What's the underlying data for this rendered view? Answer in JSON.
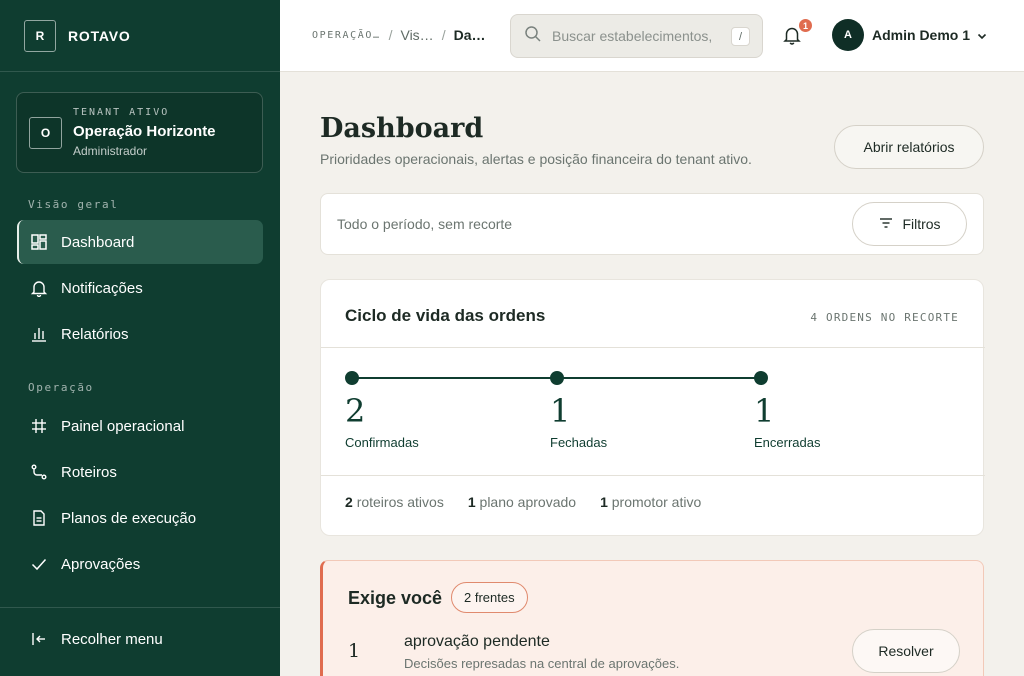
{
  "brand": {
    "mark": "R",
    "name": "ROTAVO"
  },
  "tenant": {
    "mark": "O",
    "caption": "TENANT ATIVO",
    "name": "Operação Horizonte",
    "role": "Administrador"
  },
  "sidebar": {
    "sections": [
      {
        "label": "Visão geral"
      },
      {
        "label": "Operação"
      }
    ],
    "items": [
      {
        "label": "Dashboard",
        "icon": "dashboard-icon",
        "active": true
      },
      {
        "label": "Notificações",
        "icon": "bell-icon"
      },
      {
        "label": "Relatórios",
        "icon": "bar-chart-icon"
      },
      {
        "label": "Painel operacional",
        "icon": "grid-icon"
      },
      {
        "label": "Roteiros",
        "icon": "route-icon"
      },
      {
        "label": "Planos de execução",
        "icon": "document-icon"
      },
      {
        "label": "Aprovações",
        "icon": "check-icon"
      }
    ],
    "collapse_label": "Recolher menu"
  },
  "topbar": {
    "breadcrumb": [
      "OPERAÇÃO…",
      "Vis…",
      "Da…"
    ],
    "search_placeholder": "Buscar estabelecimentos,",
    "search_shortcut": "/",
    "notifications_count": "1",
    "user": {
      "initial": "A",
      "name": "Admin Demo 1"
    }
  },
  "page": {
    "title": "Dashboard",
    "subtitle": "Prioridades operacionais, alertas e posição financeira do tenant ativo.",
    "reports_button": "Abrir relatórios"
  },
  "filters": {
    "summary": "Todo o período, sem recorte",
    "button": "Filtros"
  },
  "lifecycle": {
    "title": "Ciclo de vida das ordens",
    "meta": "4 ORDENS NO RECORTE",
    "stages": [
      {
        "value": "2",
        "label": "Confirmadas"
      },
      {
        "value": "1",
        "label": "Fechadas"
      },
      {
        "value": "1",
        "label": "Encerradas"
      }
    ],
    "stats": [
      {
        "value": "2",
        "label": "roteiros ativos"
      },
      {
        "value": "1",
        "label": "plano aprovado"
      },
      {
        "value": "1",
        "label": "promotor ativo"
      }
    ]
  },
  "attention": {
    "title": "Exige você",
    "badge": "2 frentes",
    "items": [
      {
        "count": "1",
        "title": "aprovação pendente",
        "description": "Decisões represadas na central de aprovações.",
        "action": "Resolver"
      }
    ]
  },
  "colors": {
    "sidebar": "#0f3d30",
    "accent": "#e06c4f",
    "background": "#f3f1ec"
  }
}
